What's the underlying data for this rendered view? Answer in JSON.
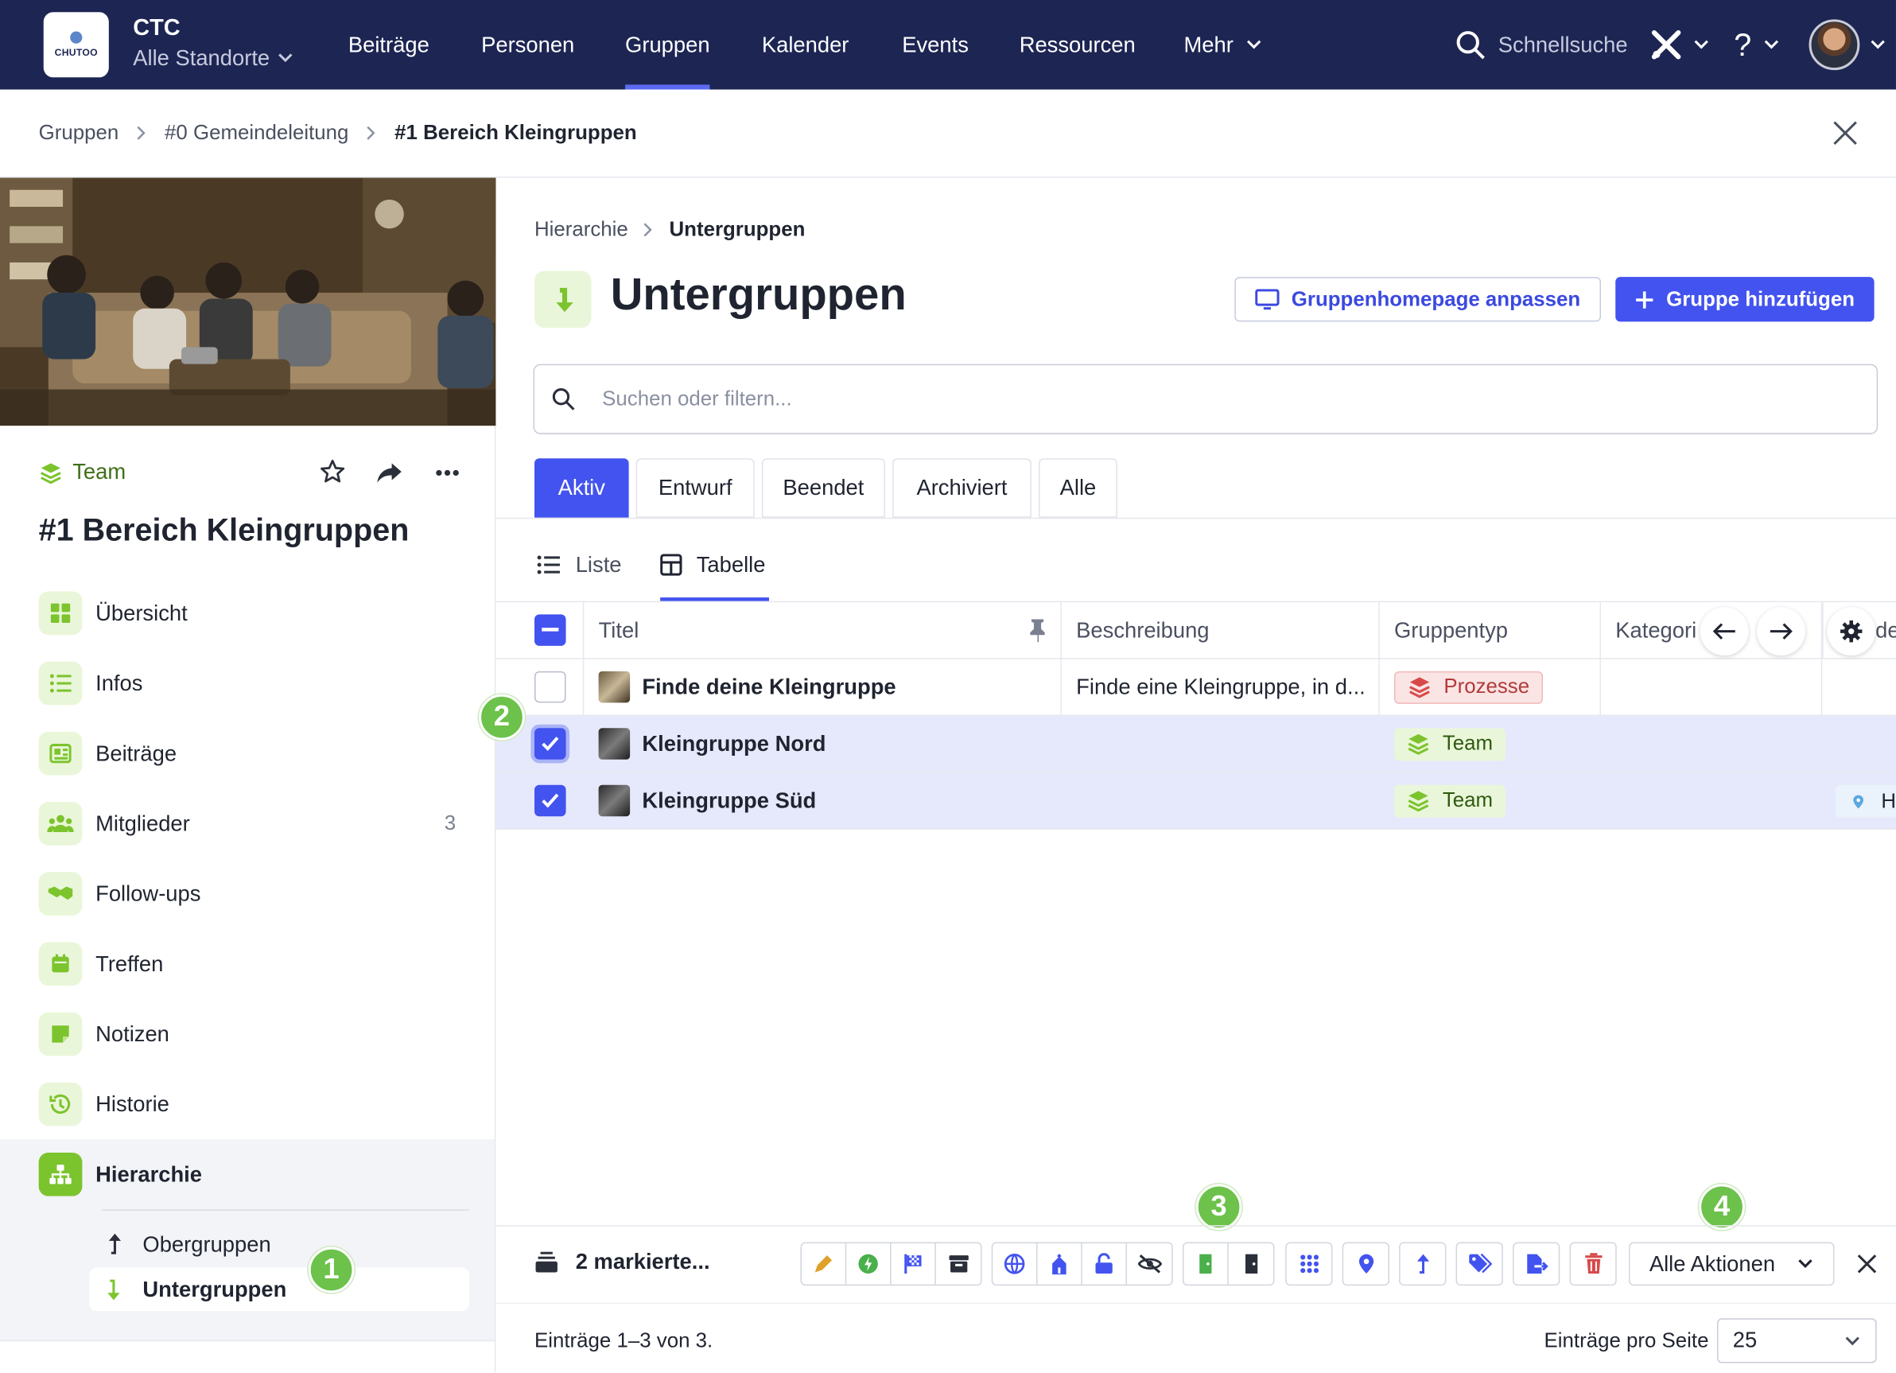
{
  "topbar": {
    "logo_text": "CHUTOO",
    "org_name": "CTC",
    "location": "Alle Standorte",
    "nav": [
      "Beiträge",
      "Personen",
      "Gruppen",
      "Kalender",
      "Events",
      "Ressourcen",
      "Mehr"
    ],
    "active_nav": "Gruppen",
    "search_label": "Schnellsuche",
    "help_label": "?"
  },
  "breadcrumb": [
    "Gruppen",
    "#0 Gemeindeleitung",
    "#1 Bereich Kleingruppen"
  ],
  "group": {
    "type": "Team",
    "title": "#1 Bereich Kleingruppen"
  },
  "sidebar": {
    "items": [
      {
        "label": "Übersicht",
        "icon": "grid-icon"
      },
      {
        "label": "Infos",
        "icon": "list-icon"
      },
      {
        "label": "Beiträge",
        "icon": "newspaper-icon"
      },
      {
        "label": "Mitglieder",
        "icon": "users-icon",
        "count": "3"
      },
      {
        "label": "Follow-ups",
        "icon": "handshake-icon"
      },
      {
        "label": "Treffen",
        "icon": "calendar-icon"
      },
      {
        "label": "Notizen",
        "icon": "note-icon"
      },
      {
        "label": "Historie",
        "icon": "history-icon"
      },
      {
        "label": "Hierarchie",
        "icon": "hierarchy-icon",
        "active": true
      }
    ],
    "subitems": [
      {
        "label": "Obergruppen",
        "icon": "arrow-up-icon"
      },
      {
        "label": "Untergruppen",
        "icon": "arrow-down-icon",
        "active": true
      }
    ]
  },
  "main": {
    "crumb_parent": "Hierarchie",
    "crumb_current": "Untergruppen",
    "title": "Untergruppen",
    "btn_customize": "Gruppenhomepage anpassen",
    "btn_add": "Gruppe hinzufügen",
    "search_placeholder": "Suchen oder filtern...",
    "tabs": [
      "Aktiv",
      "Entwurf",
      "Beendet",
      "Archiviert",
      "Alle"
    ],
    "active_tab": "Aktiv",
    "views": [
      "Liste",
      "Tabelle"
    ],
    "active_view": "Tabelle"
  },
  "table": {
    "columns": [
      "Titel",
      "Beschreibung",
      "Gruppentyp",
      "Kategori"
    ],
    "clipped_column": "de",
    "rows": [
      {
        "title": "Finde deine Kleingruppe",
        "description": "Finde eine Kleingruppe, in d...",
        "type": "Prozesse",
        "selected": false
      },
      {
        "title": "Kleingruppe Nord",
        "description": "",
        "type": "Team",
        "selected": true
      },
      {
        "title": "Kleingruppe Süd",
        "description": "",
        "type": "Team",
        "selected": true,
        "clipped_extra": "H"
      }
    ]
  },
  "actions": {
    "selected_label": "2 markierte...",
    "all_actions": "Alle Aktionen"
  },
  "footer": {
    "range": "Einträge 1–3 von 3.",
    "per_page_label": "Einträge pro Seite",
    "per_page": "25"
  },
  "annotations": [
    "1",
    "2",
    "3",
    "4"
  ],
  "colors": {
    "topbar": "#1d2553",
    "primary": "#4353ef",
    "green": "#7cc42e",
    "selected_row": "#e6e9fb",
    "annotation": "#6cc24a"
  }
}
